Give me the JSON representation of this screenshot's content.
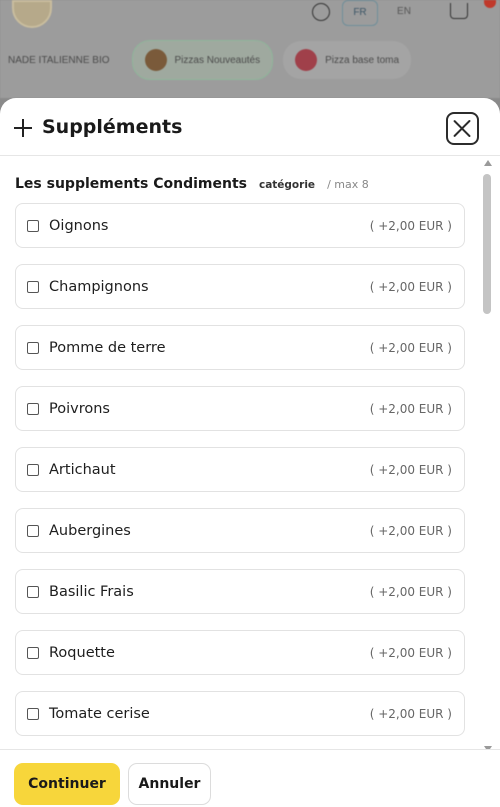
{
  "background": {
    "languages": [
      "FR",
      "EN"
    ],
    "categories": [
      "NADE ITALIENNE BIO",
      "Pizzas Nouveautés",
      "Pizza base toma"
    ]
  },
  "modal": {
    "title": "Suppléments",
    "close_icon": "close-icon",
    "section": {
      "title": "Les supplements Condiments",
      "category_badge": "catégorie",
      "max": "/ max 8"
    },
    "options": [
      {
        "label": "Oignons",
        "price": "( +2,00 EUR )"
      },
      {
        "label": "Champignons",
        "price": "( +2,00 EUR )"
      },
      {
        "label": "Pomme de terre",
        "price": "( +2,00 EUR )"
      },
      {
        "label": "Poivrons",
        "price": "( +2,00 EUR )"
      },
      {
        "label": "Artichaut",
        "price": "( +2,00 EUR )"
      },
      {
        "label": "Aubergines",
        "price": "( +2,00 EUR )"
      },
      {
        "label": "Basilic Frais",
        "price": "( +2,00 EUR )"
      },
      {
        "label": "Roquette",
        "price": "( +2,00 EUR )"
      },
      {
        "label": "Tomate cerise",
        "price": "( +2,00 EUR )"
      }
    ],
    "footer": {
      "continue_label": "Continuer",
      "cancel_label": "Annuler"
    }
  },
  "colors": {
    "continue_bg": "#f7d63b",
    "overlay": "#8a8a8a"
  }
}
